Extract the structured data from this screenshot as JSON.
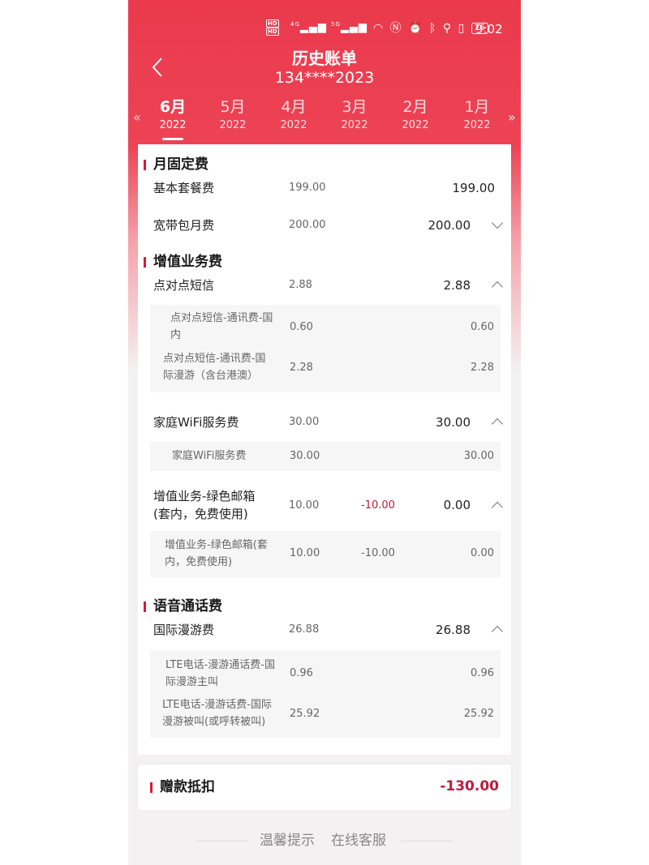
{
  "status_bar": {
    "hd1": "HD",
    "hd2": "HD",
    "net1": "4G",
    "net2": "5G",
    "battery": "26",
    "time": "9:02"
  },
  "header": {
    "title": "历史账单",
    "phone": "134****2023"
  },
  "tabs": [
    {
      "month": "6月",
      "year": "2022"
    },
    {
      "month": "5月",
      "year": "2022"
    },
    {
      "month": "4月",
      "year": "2022"
    },
    {
      "month": "3月",
      "year": "2022"
    },
    {
      "month": "2月",
      "year": "2022"
    },
    {
      "month": "1月",
      "year": "2022"
    }
  ],
  "sections": {
    "fixed": {
      "title": "月固定费",
      "items": [
        {
          "name": "基本套餐费",
          "original": "199.00",
          "total": "199.00"
        },
        {
          "name": "宽带包月费",
          "original": "200.00",
          "total": "200.00"
        }
      ]
    },
    "value_added": {
      "title": "增值业务费",
      "items": [
        {
          "name": "点对点短信",
          "original": "2.88",
          "total": "2.88",
          "details": [
            {
              "name_l1": "点对点短信-通讯费-国",
              "name_l2": "内",
              "original": "0.60",
              "total": "0.60"
            },
            {
              "name_l1": "点对点短信-通讯费-国",
              "name_l2": "际漫游（含台港澳）",
              "original": "2.28",
              "total": "2.28"
            }
          ]
        },
        {
          "name": "家庭WiFi服务费",
          "original": "30.00",
          "total": "30.00",
          "details": [
            {
              "name": "家庭WiFi服务费",
              "original": "30.00",
              "total": "30.00"
            }
          ]
        },
        {
          "name_l1": "增值业务-绿色邮箱",
          "name_l2": "(套内，免费使用)",
          "original": "10.00",
          "discount": "-10.00",
          "total": "0.00",
          "details": [
            {
              "name_l1": "增值业务-绿色邮箱(套",
              "name_l2": "内，免费使用)",
              "original": "10.00",
              "discount": "-10.00",
              "total": "0.00"
            }
          ]
        }
      ]
    },
    "voice": {
      "title": "语音通话费",
      "items": [
        {
          "name": "国际漫游费",
          "original": "26.88",
          "total": "26.88",
          "details": [
            {
              "name_l1": "LTE电话-漫游通话费-国",
              "name_l2": "际漫游主叫",
              "original": "0.96",
              "total": "0.96"
            },
            {
              "name_l1": "LTE电话-漫游话费-国际",
              "name_l2": "漫游被叫(或呼转被叫)",
              "original": "25.92",
              "total": "25.92"
            }
          ]
        }
      ]
    }
  },
  "deduction": {
    "label": "赠款抵扣",
    "value": "-130.00"
  },
  "footer": {
    "tips": "温馨提示",
    "service": "在线客服"
  },
  "colors": {
    "header_red": "#ea3a4c",
    "accent_red": "#d41d35",
    "discount_red": "#c0193a"
  }
}
